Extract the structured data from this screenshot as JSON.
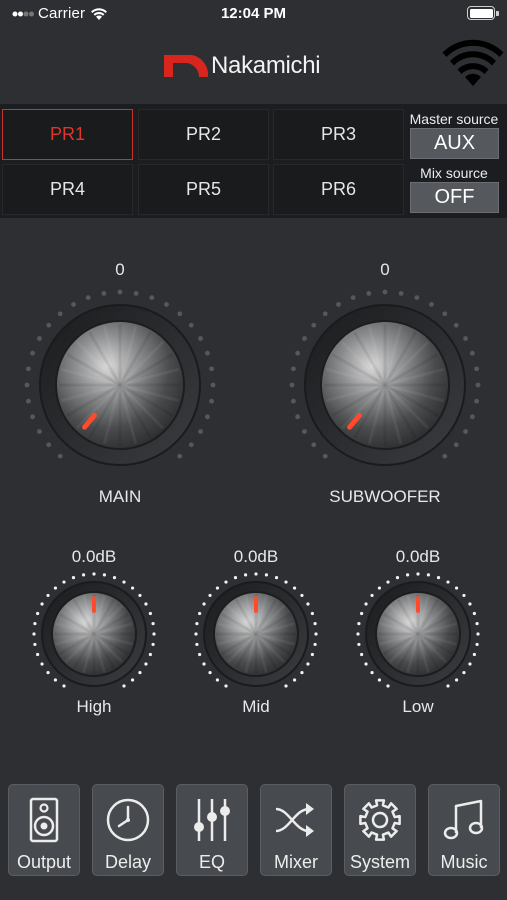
{
  "status": {
    "carrier": "Carrier",
    "time": "12:04 PM"
  },
  "brand": {
    "name": "Nakamichi",
    "accent": "#d8261e"
  },
  "presets": [
    {
      "label": "PR1",
      "active": true
    },
    {
      "label": "PR2",
      "active": false
    },
    {
      "label": "PR3",
      "active": false
    },
    {
      "label": "PR4",
      "active": false
    },
    {
      "label": "PR5",
      "active": false
    },
    {
      "label": "PR6",
      "active": false
    }
  ],
  "master_source": {
    "label": "Master source",
    "value": "AUX"
  },
  "mix_source": {
    "label": "Mix source",
    "value": "OFF"
  },
  "volume_knobs": [
    {
      "label": "MAIN",
      "value": "0"
    },
    {
      "label": "SUBWOOFER",
      "value": "0"
    }
  ],
  "tone_knobs": [
    {
      "label": "High",
      "value": "0.0dB"
    },
    {
      "label": "Mid",
      "value": "0.0dB"
    },
    {
      "label": "Low",
      "value": "0.0dB"
    }
  ],
  "tabs": [
    {
      "label": "Output",
      "icon": "speaker-icon"
    },
    {
      "label": "Delay",
      "icon": "clock-icon"
    },
    {
      "label": "EQ",
      "icon": "equalizer-sliders-icon"
    },
    {
      "label": "Mixer",
      "icon": "shuffle-icon"
    },
    {
      "label": "System",
      "icon": "gear-icon"
    },
    {
      "label": "Music",
      "icon": "music-note-icon"
    }
  ]
}
